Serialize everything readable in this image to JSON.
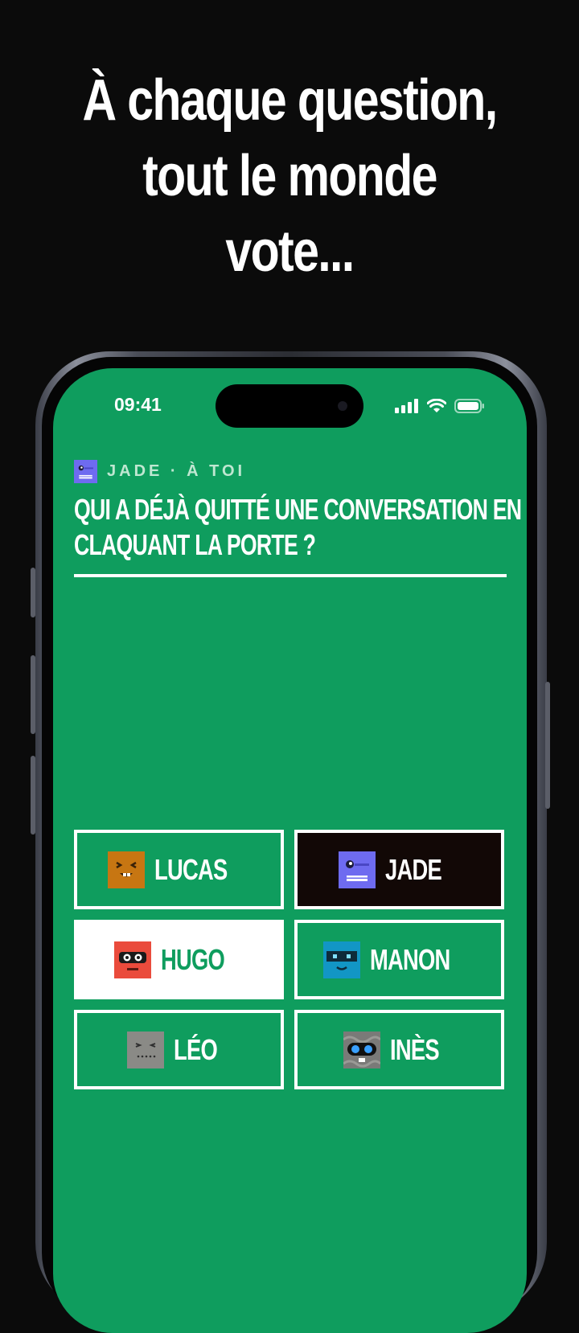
{
  "headline": {
    "line1": "À chaque question,",
    "line2": "tout le monde",
    "line3": "vote..."
  },
  "status_bar": {
    "time": "09:41",
    "icons": [
      "signal-icon",
      "wifi-icon",
      "battery-icon"
    ]
  },
  "question_card": {
    "player_turn": "JADE · À TOI",
    "question_line1": "QUI A DÉJÀ QUITTÉ UNE CONVERSATION EN",
    "question_line2": "CLAQUANT LA PORTE ?"
  },
  "players": [
    {
      "name": "LUCAS",
      "avatar": "lucas-avatar-icon",
      "color": "#c77612",
      "state": "default"
    },
    {
      "name": "JADE",
      "avatar": "jade-avatar-icon",
      "color": "#6e6bf0",
      "state": "current-player"
    },
    {
      "name": "HUGO",
      "avatar": "hugo-avatar-icon",
      "color": "#ea4b3c",
      "state": "selected"
    },
    {
      "name": "MANON",
      "avatar": "manon-avatar-icon",
      "color": "#1296c5",
      "state": "default"
    },
    {
      "name": "LÉO",
      "avatar": "leo-avatar-icon",
      "color": "#8a8a86",
      "state": "default"
    },
    {
      "name": "INÈS",
      "avatar": "ines-avatar-icon",
      "color": "#7a7a78",
      "state": "default"
    }
  ],
  "colors": {
    "background": "#0b0b0b",
    "screen": "#0f9d5e",
    "tile_border": "#ffffff",
    "current_player_tile": "#120806",
    "selected_tile": "#ffffff"
  }
}
